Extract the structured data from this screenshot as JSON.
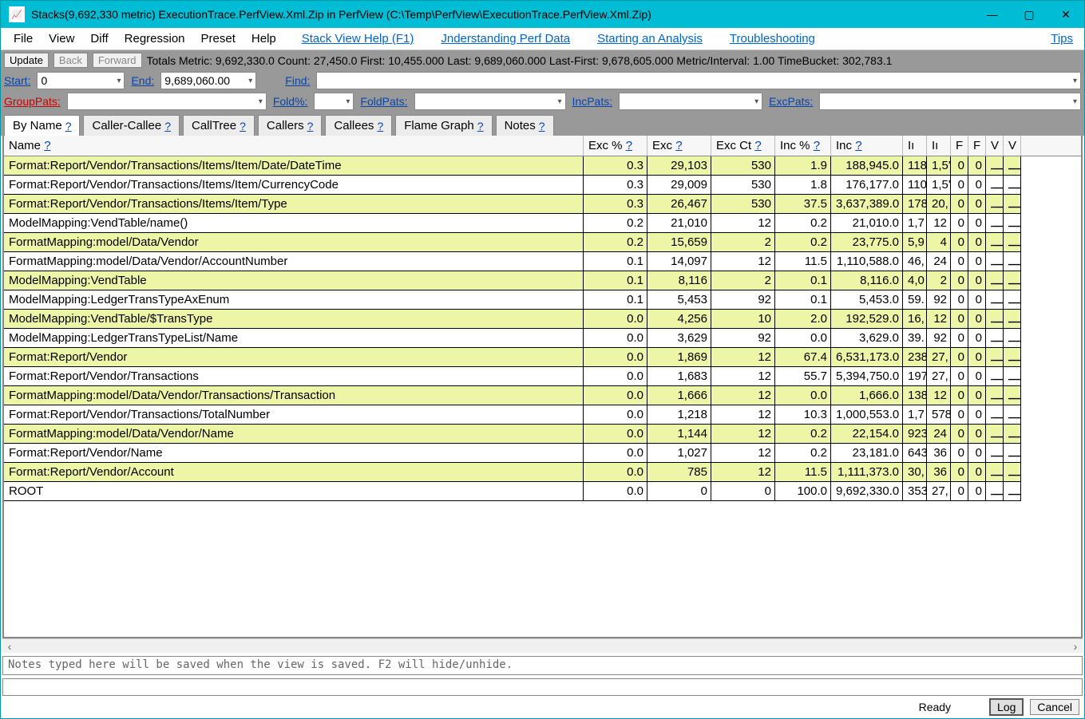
{
  "window": {
    "title": "Stacks(9,692,330 metric) ExecutionTrace.PerfView.Xml.Zip in PerfView (C:\\Temp\\PerfView\\ExecutionTrace.PerfView.Xml.Zip)"
  },
  "menu": {
    "items": [
      "File",
      "View",
      "Diff",
      "Regression",
      "Preset",
      "Help"
    ],
    "links": [
      "Stack View Help (F1)",
      "Jnderstanding Perf Data",
      "Starting an Analysis",
      "Troubleshooting",
      "Tips"
    ]
  },
  "toolbar": {
    "update": "Update",
    "back": "Back",
    "forward": "Forward",
    "stats": "Totals Metric: 9,692,330.0   Count: 27,450.0   First: 10,455.000 Last: 9,689,060.000   Last-First: 9,678,605.000   Metric/Interval: 1.00   TimeBucket: 302,783.1"
  },
  "filters": {
    "start_label": "Start:",
    "start_value": "0",
    "end_label": "End:",
    "end_value": "9,689,060.00",
    "find_label": "Find:",
    "find_value": "",
    "grouppats_label": "GroupPats:",
    "grouppats_value": "",
    "foldpct_label": "Fold%:",
    "foldpct_value": "",
    "foldpats_label": "FoldPats:",
    "foldpats_value": "",
    "incpats_label": "IncPats:",
    "incpats_value": "",
    "excpats_label": "ExcPats:",
    "excpats_value": ""
  },
  "tabs": [
    "By Name",
    "Caller-Callee",
    "CallTree",
    "Callers",
    "Callees",
    "Flame Graph",
    "Notes"
  ],
  "columns": [
    "Name",
    "Exc %",
    "Exc",
    "Exc Ct",
    "Inc %",
    "Inc",
    "Iı",
    "Iı",
    "F",
    "F",
    "V",
    "V"
  ],
  "rows": [
    {
      "name": "Format:Report/Vendor/Transactions/Items/Item/Date/DateTime",
      "excp": "0.3",
      "exc": "29,103",
      "excct": "530",
      "incp": "1.9",
      "inc": "188,945.0",
      "c1": "118",
      "c2": "1,5'",
      "c3": "0",
      "c4": "0"
    },
    {
      "name": "Format:Report/Vendor/Transactions/Items/Item/CurrencyCode",
      "excp": "0.3",
      "exc": "29,009",
      "excct": "530",
      "incp": "1.8",
      "inc": "176,177.0",
      "c1": "110",
      "c2": "1,5'",
      "c3": "0",
      "c4": "0"
    },
    {
      "name": "Format:Report/Vendor/Transactions/Items/Item/Type",
      "excp": "0.3",
      "exc": "26,467",
      "excct": "530",
      "incp": "37.5",
      "inc": "3,637,389.0",
      "c1": "178",
      "c2": "20,",
      "c3": "0",
      "c4": "0"
    },
    {
      "name": "ModelMapping:VendTable/name()",
      "excp": "0.2",
      "exc": "21,010",
      "excct": "12",
      "incp": "0.2",
      "inc": "21,010.0",
      "c1": "1,7",
      "c2": "12",
      "c3": "0",
      "c4": "0"
    },
    {
      "name": "FormatMapping:model/Data/Vendor",
      "excp": "0.2",
      "exc": "15,659",
      "excct": "2",
      "incp": "0.2",
      "inc": "23,775.0",
      "c1": "5,9",
      "c2": "4",
      "c3": "0",
      "c4": "0"
    },
    {
      "name": "FormatMapping:model/Data/Vendor/AccountNumber",
      "excp": "0.1",
      "exc": "14,097",
      "excct": "12",
      "incp": "11.5",
      "inc": "1,110,588.0",
      "c1": "46,",
      "c2": "24",
      "c3": "0",
      "c4": "0"
    },
    {
      "name": "ModelMapping:VendTable",
      "excp": "0.1",
      "exc": "8,116",
      "excct": "2",
      "incp": "0.1",
      "inc": "8,116.0",
      "c1": "4,0",
      "c2": "2",
      "c3": "0",
      "c4": "0"
    },
    {
      "name": "ModelMapping:LedgerTransTypeAxEnum",
      "excp": "0.1",
      "exc": "5,453",
      "excct": "92",
      "incp": "0.1",
      "inc": "5,453.0",
      "c1": "59.",
      "c2": "92",
      "c3": "0",
      "c4": "0"
    },
    {
      "name": "ModelMapping:VendTable/$TransType",
      "excp": "0.0",
      "exc": "4,256",
      "excct": "10",
      "incp": "2.0",
      "inc": "192,529.0",
      "c1": "16,",
      "c2": "12",
      "c3": "0",
      "c4": "0"
    },
    {
      "name": "ModelMapping:LedgerTransTypeList/Name",
      "excp": "0.0",
      "exc": "3,629",
      "excct": "92",
      "incp": "0.0",
      "inc": "3,629.0",
      "c1": "39.",
      "c2": "92",
      "c3": "0",
      "c4": "0"
    },
    {
      "name": "Format:Report/Vendor",
      "excp": "0.0",
      "exc": "1,869",
      "excct": "12",
      "incp": "67.4",
      "inc": "6,531,173.0",
      "c1": "238",
      "c2": "27,",
      "c3": "0",
      "c4": "0"
    },
    {
      "name": "Format:Report/Vendor/Transactions",
      "excp": "0.0",
      "exc": "1,683",
      "excct": "12",
      "incp": "55.7",
      "inc": "5,394,750.0",
      "c1": "197",
      "c2": "27,",
      "c3": "0",
      "c4": "0"
    },
    {
      "name": "FormatMapping:model/Data/Vendor/Transactions/Transaction",
      "excp": "0.0",
      "exc": "1,666",
      "excct": "12",
      "incp": "0.0",
      "inc": "1,666.0",
      "c1": "138",
      "c2": "12",
      "c3": "0",
      "c4": "0"
    },
    {
      "name": "Format:Report/Vendor/Transactions/TotalNumber",
      "excp": "0.0",
      "exc": "1,218",
      "excct": "12",
      "incp": "10.3",
      "inc": "1,000,553.0",
      "c1": "1,7",
      "c2": "578",
      "c3": "0",
      "c4": "0"
    },
    {
      "name": "FormatMapping:model/Data/Vendor/Name",
      "excp": "0.0",
      "exc": "1,144",
      "excct": "12",
      "incp": "0.2",
      "inc": "22,154.0",
      "c1": "923",
      "c2": "24",
      "c3": "0",
      "c4": "0"
    },
    {
      "name": "Format:Report/Vendor/Name",
      "excp": "0.0",
      "exc": "1,027",
      "excct": "12",
      "incp": "0.2",
      "inc": "23,181.0",
      "c1": "643",
      "c2": "36",
      "c3": "0",
      "c4": "0"
    },
    {
      "name": "Format:Report/Vendor/Account",
      "excp": "0.0",
      "exc": "785",
      "excct": "12",
      "incp": "11.5",
      "inc": "1,111,373.0",
      "c1": "30,",
      "c2": "36",
      "c3": "0",
      "c4": "0"
    },
    {
      "name": "ROOT",
      "excp": "0.0",
      "exc": "0",
      "excct": "0",
      "incp": "100.0",
      "inc": "9,692,330.0",
      "c1": "353",
      "c2": "27,",
      "c3": "0",
      "c4": "0"
    }
  ],
  "notes_placeholder": "Notes typed here will be saved when the view is saved. F2 will hide/unhide.",
  "status": {
    "ready": "Ready",
    "log": "Log",
    "cancel": "Cancel"
  }
}
